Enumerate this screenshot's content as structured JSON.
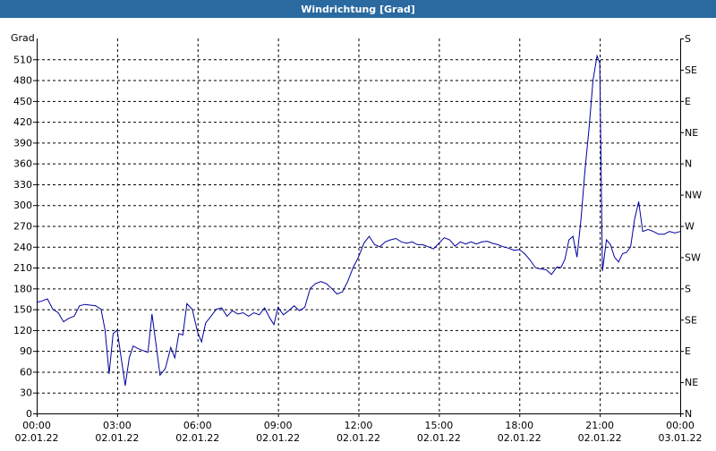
{
  "window": {
    "title": "Windrichtung [Grad]"
  },
  "chart_data": {
    "type": "line",
    "title": "Windrichtung [Grad]",
    "ylabel": "Grad",
    "ylim": [
      0,
      540
    ],
    "yticks": [
      0,
      30,
      60,
      90,
      120,
      150,
      180,
      210,
      240,
      270,
      300,
      330,
      360,
      390,
      420,
      450,
      480,
      510
    ],
    "right_axis_labels": [
      {
        "value": 0,
        "label": "N"
      },
      {
        "value": 45,
        "label": "NE"
      },
      {
        "value": 90,
        "label": "E"
      },
      {
        "value": 135,
        "label": "SE"
      },
      {
        "value": 180,
        "label": "S"
      },
      {
        "value": 225,
        "label": "SW"
      },
      {
        "value": 270,
        "label": "W"
      },
      {
        "value": 315,
        "label": "NW"
      },
      {
        "value": 360,
        "label": "N"
      },
      {
        "value": 405,
        "label": "NE"
      },
      {
        "value": 450,
        "label": "E"
      },
      {
        "value": 495,
        "label": "SE"
      },
      {
        "value": 540,
        "label": "S"
      }
    ],
    "xlim_hours": [
      0,
      24
    ],
    "xticks": [
      {
        "h": 0,
        "time": "00:00",
        "date": "02.01.22"
      },
      {
        "h": 3,
        "time": "03:00",
        "date": "02.01.22"
      },
      {
        "h": 6,
        "time": "06:00",
        "date": "02.01.22"
      },
      {
        "h": 9,
        "time": "09:00",
        "date": "02.01.22"
      },
      {
        "h": 12,
        "time": "12:00",
        "date": "02.01.22"
      },
      {
        "h": 15,
        "time": "15:00",
        "date": "02.01.22"
      },
      {
        "h": 18,
        "time": "18:00",
        "date": "02.01.22"
      },
      {
        "h": 21,
        "time": "21:00",
        "date": "02.01.22"
      },
      {
        "h": 24,
        "time": "00:00",
        "date": "03.01.22"
      }
    ],
    "grid": true,
    "series": [
      {
        "color": "#0000a0",
        "points": [
          [
            0.0,
            160
          ],
          [
            0.2,
            162
          ],
          [
            0.4,
            165
          ],
          [
            0.6,
            150
          ],
          [
            0.8,
            145
          ],
          [
            1.0,
            132
          ],
          [
            1.2,
            137
          ],
          [
            1.4,
            140
          ],
          [
            1.6,
            155
          ],
          [
            1.8,
            157
          ],
          [
            2.0,
            156
          ],
          [
            2.2,
            155
          ],
          [
            2.4,
            150
          ],
          [
            2.55,
            120
          ],
          [
            2.7,
            57
          ],
          [
            2.85,
            115
          ],
          [
            3.0,
            120
          ],
          [
            3.15,
            80
          ],
          [
            3.3,
            40
          ],
          [
            3.45,
            80
          ],
          [
            3.6,
            97
          ],
          [
            3.8,
            93
          ],
          [
            4.0,
            90
          ],
          [
            4.15,
            88
          ],
          [
            4.3,
            143
          ],
          [
            4.45,
            100
          ],
          [
            4.6,
            55
          ],
          [
            4.8,
            65
          ],
          [
            5.0,
            95
          ],
          [
            5.15,
            80
          ],
          [
            5.3,
            115
          ],
          [
            5.45,
            113
          ],
          [
            5.6,
            158
          ],
          [
            5.8,
            150
          ],
          [
            6.0,
            117
          ],
          [
            6.15,
            103
          ],
          [
            6.3,
            130
          ],
          [
            6.5,
            140
          ],
          [
            6.7,
            150
          ],
          [
            6.9,
            152
          ],
          [
            7.1,
            140
          ],
          [
            7.3,
            148
          ],
          [
            7.5,
            143
          ],
          [
            7.7,
            145
          ],
          [
            7.9,
            140
          ],
          [
            8.1,
            145
          ],
          [
            8.3,
            142
          ],
          [
            8.5,
            152
          ],
          [
            8.7,
            137
          ],
          [
            8.85,
            128
          ],
          [
            9.0,
            153
          ],
          [
            9.2,
            142
          ],
          [
            9.4,
            148
          ],
          [
            9.6,
            155
          ],
          [
            9.8,
            148
          ],
          [
            10.0,
            153
          ],
          [
            10.2,
            180
          ],
          [
            10.4,
            187
          ],
          [
            10.6,
            190
          ],
          [
            10.8,
            187
          ],
          [
            11.0,
            180
          ],
          [
            11.2,
            172
          ],
          [
            11.4,
            175
          ],
          [
            11.6,
            190
          ],
          [
            11.8,
            210
          ],
          [
            12.0,
            225
          ],
          [
            12.2,
            245
          ],
          [
            12.4,
            255
          ],
          [
            12.6,
            243
          ],
          [
            12.8,
            240
          ],
          [
            13.0,
            247
          ],
          [
            13.2,
            250
          ],
          [
            13.4,
            252
          ],
          [
            13.6,
            247
          ],
          [
            13.8,
            245
          ],
          [
            14.0,
            247
          ],
          [
            14.2,
            243
          ],
          [
            14.4,
            243
          ],
          [
            14.6,
            240
          ],
          [
            14.8,
            237
          ],
          [
            15.0,
            245
          ],
          [
            15.2,
            253
          ],
          [
            15.4,
            250
          ],
          [
            15.6,
            241
          ],
          [
            15.8,
            247
          ],
          [
            16.0,
            244
          ],
          [
            16.2,
            247
          ],
          [
            16.4,
            244
          ],
          [
            16.6,
            247
          ],
          [
            16.8,
            248
          ],
          [
            17.0,
            245
          ],
          [
            17.2,
            243
          ],
          [
            17.4,
            240
          ],
          [
            17.6,
            238
          ],
          [
            17.8,
            235
          ],
          [
            18.0,
            236
          ],
          [
            18.2,
            230
          ],
          [
            18.4,
            221
          ],
          [
            18.6,
            210
          ],
          [
            18.8,
            208
          ],
          [
            19.0,
            207
          ],
          [
            19.2,
            200
          ],
          [
            19.4,
            211
          ],
          [
            19.55,
            210
          ],
          [
            19.7,
            222
          ],
          [
            19.85,
            250
          ],
          [
            20.0,
            255
          ],
          [
            20.15,
            225
          ],
          [
            20.3,
            280
          ],
          [
            20.45,
            350
          ],
          [
            20.6,
            410
          ],
          [
            20.75,
            480
          ],
          [
            20.9,
            515
          ],
          [
            21.0,
            505
          ],
          [
            21.1,
            205
          ],
          [
            21.25,
            250
          ],
          [
            21.4,
            243
          ],
          [
            21.55,
            225
          ],
          [
            21.7,
            218
          ],
          [
            21.85,
            230
          ],
          [
            22.0,
            232
          ],
          [
            22.15,
            240
          ],
          [
            22.3,
            280
          ],
          [
            22.45,
            305
          ],
          [
            22.6,
            262
          ],
          [
            22.8,
            265
          ],
          [
            23.0,
            262
          ],
          [
            23.2,
            258
          ],
          [
            23.4,
            258
          ],
          [
            23.6,
            262
          ],
          [
            23.8,
            260
          ],
          [
            24.0,
            262
          ]
        ]
      }
    ]
  }
}
